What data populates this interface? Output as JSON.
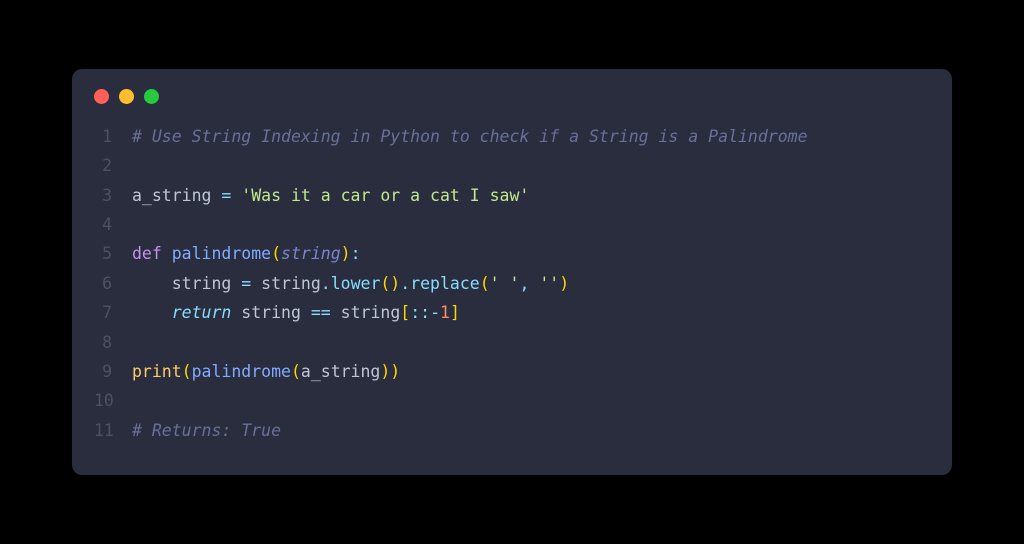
{
  "window": {
    "dots": [
      "red",
      "yellow",
      "green"
    ]
  },
  "code": {
    "lines": [
      {
        "num": "1",
        "tokens": [
          {
            "cls": "tok-comment",
            "t": "# Use String Indexing in Python to check if a String is a Palindrome"
          }
        ]
      },
      {
        "num": "2",
        "tokens": []
      },
      {
        "num": "3",
        "tokens": [
          {
            "cls": "tok-variable",
            "t": "a_string "
          },
          {
            "cls": "tok-operator",
            "t": "="
          },
          {
            "cls": "tok-variable",
            "t": " "
          },
          {
            "cls": "tok-string",
            "t": "'Was it a car or a cat I saw'"
          }
        ]
      },
      {
        "num": "4",
        "tokens": []
      },
      {
        "num": "5",
        "tokens": [
          {
            "cls": "tok-def",
            "t": "def "
          },
          {
            "cls": "tok-funcname",
            "t": "palindrome"
          },
          {
            "cls": "tok-paren",
            "t": "("
          },
          {
            "cls": "tok-param",
            "t": "string"
          },
          {
            "cls": "tok-paren",
            "t": ")"
          },
          {
            "cls": "tok-punct",
            "t": ":"
          }
        ]
      },
      {
        "num": "6",
        "tokens": [
          {
            "cls": "tok-variable",
            "t": "    string "
          },
          {
            "cls": "tok-operator",
            "t": "="
          },
          {
            "cls": "tok-variable",
            "t": " string"
          },
          {
            "cls": "tok-punct",
            "t": "."
          },
          {
            "cls": "tok-method",
            "t": "lower"
          },
          {
            "cls": "tok-paren",
            "t": "()"
          },
          {
            "cls": "tok-punct",
            "t": "."
          },
          {
            "cls": "tok-method",
            "t": "replace"
          },
          {
            "cls": "tok-paren",
            "t": "("
          },
          {
            "cls": "tok-string",
            "t": "' '"
          },
          {
            "cls": "tok-punct",
            "t": ","
          },
          {
            "cls": "tok-variable",
            "t": " "
          },
          {
            "cls": "tok-string",
            "t": "''"
          },
          {
            "cls": "tok-paren",
            "t": ")"
          }
        ]
      },
      {
        "num": "7",
        "tokens": [
          {
            "cls": "tok-variable",
            "t": "    "
          },
          {
            "cls": "tok-return",
            "t": "return"
          },
          {
            "cls": "tok-variable",
            "t": " string "
          },
          {
            "cls": "tok-operator",
            "t": "=="
          },
          {
            "cls": "tok-variable",
            "t": " string"
          },
          {
            "cls": "tok-paren",
            "t": "["
          },
          {
            "cls": "tok-punct",
            "t": "::"
          },
          {
            "cls": "tok-operator",
            "t": "-"
          },
          {
            "cls": "tok-number",
            "t": "1"
          },
          {
            "cls": "tok-paren",
            "t": "]"
          }
        ]
      },
      {
        "num": "8",
        "tokens": []
      },
      {
        "num": "9",
        "tokens": [
          {
            "cls": "tok-builtin",
            "t": "print"
          },
          {
            "cls": "tok-paren",
            "t": "("
          },
          {
            "cls": "tok-call",
            "t": "palindrome"
          },
          {
            "cls": "tok-paren",
            "t": "("
          },
          {
            "cls": "tok-variable",
            "t": "a_string"
          },
          {
            "cls": "tok-paren",
            "t": "))"
          }
        ]
      },
      {
        "num": "10",
        "tokens": []
      },
      {
        "num": "11",
        "tokens": [
          {
            "cls": "tok-comment",
            "t": "# Returns: True"
          }
        ]
      }
    ]
  }
}
